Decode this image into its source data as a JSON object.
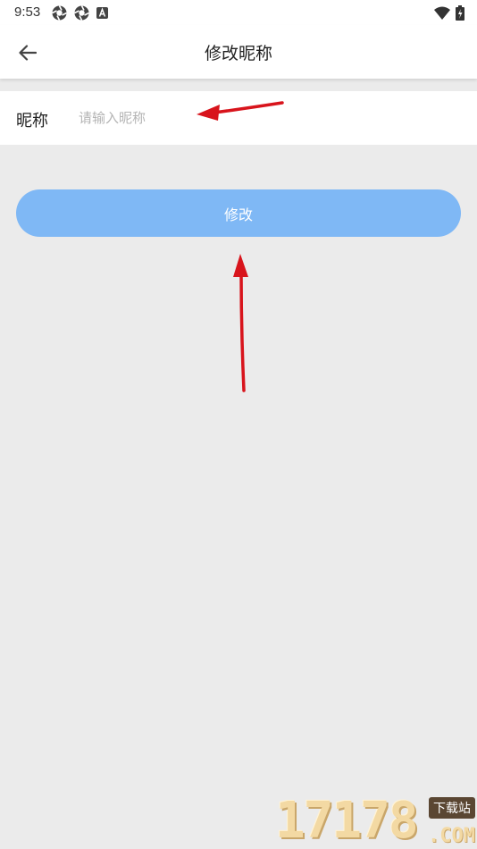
{
  "status_bar": {
    "time": "9:53",
    "left_icons": [
      "shutter-icon",
      "shutter-icon",
      "a-badge-icon"
    ],
    "right_icons": [
      "wifi-icon",
      "battery-icon"
    ]
  },
  "app_bar": {
    "back_icon": "back-arrow-icon",
    "title": "修改昵称"
  },
  "form": {
    "nickname_label": "昵称",
    "nickname_placeholder": "请输入昵称",
    "nickname_value": "",
    "submit_label": "修改"
  },
  "watermark": {
    "digits": "17178",
    "site": "下载站",
    "domain": ".COM"
  },
  "colors": {
    "background": "#ebebeb",
    "button": "#7fb8f5",
    "arrow": "#d8141c"
  }
}
